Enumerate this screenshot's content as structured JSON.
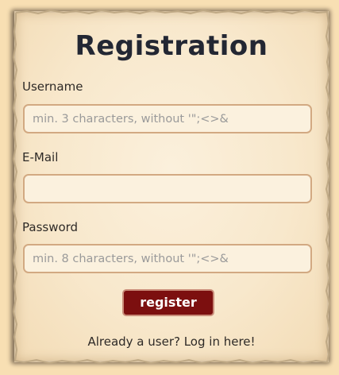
{
  "form": {
    "title": "Registration",
    "username_label": "Username",
    "username_placeholder": "min. 3 characters, without '\";<>&",
    "username_value": "",
    "email_label": "E-Mail",
    "email_placeholder": "",
    "email_value": "",
    "password_label": "Password",
    "password_placeholder": "min. 8 characters, without '\";<>&",
    "password_value": "",
    "register_label": "register",
    "login_link_text": "Already a user? Log in here!"
  },
  "colors": {
    "background": "#f8dfb3",
    "parchment": "#f8e8cc",
    "field_border": "#d2a982",
    "button_bg": "#7c0f0f",
    "title_text": "#232733"
  }
}
